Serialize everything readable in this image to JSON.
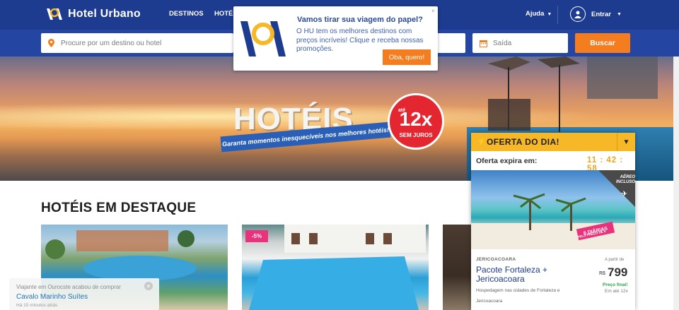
{
  "header": {
    "brand": "Hotel Urbano",
    "nav": [
      "DESTINOS",
      "HOTÉ"
    ],
    "help": "Ajuda",
    "login": "Entrar"
  },
  "search": {
    "destination_placeholder": "Procure por um destino ou hotel",
    "checkout_placeholder": "Saída",
    "button": "Buscar"
  },
  "hero": {
    "title": "HOTÉIS",
    "tagline": "Garanta momentos inesquecíveis nos melhores hotéis!",
    "badge_prefix": "até",
    "badge_value": "12x",
    "badge_suffix": "SEM JUROS"
  },
  "popup": {
    "title": "Vamos tirar sua viagem do papel?",
    "body": "O HU tem os melhores destinos com preços incríveis! Clique e receba nossas promoções.",
    "button": "Oba, quero!",
    "close": "×"
  },
  "section": {
    "title": "HOTÉIS EM DESTAQUE"
  },
  "cards": [
    {
      "discount": "-5%"
    }
  ],
  "toast": {
    "line1": "Viajante em Ourocste acabou de comprar",
    "hotel": "Cavalo Marinho Suítes",
    "time": "Há 15 minutos atrás"
  },
  "offer": {
    "header": "OFERTA DO DIA!",
    "expires_label": "Oferta expira em:",
    "timer": "11 : 42 : 58",
    "air_badge": "AÉREO INCLUSO",
    "daily_badge": "6 DIÁRIAS",
    "daily_sub": "PELO PREÇO DE 5",
    "location": "JERICOACOARA",
    "title": "Pacote Fortaleza + Jericoacoara",
    "description": "Hospedagem nas cidades de Fortaleza e Jericoacoara",
    "from_label": "A partir de",
    "currency": "R$",
    "price": "799",
    "final_label": "Preço final!",
    "installments": "Em até 12x"
  },
  "colors": {
    "topbar": "#1d3b8f",
    "search_bar": "#2446a2",
    "accent": "#f47d20",
    "offer_header": "#f6b826",
    "timer": "#f0a51d",
    "discount": "#e8327c"
  }
}
